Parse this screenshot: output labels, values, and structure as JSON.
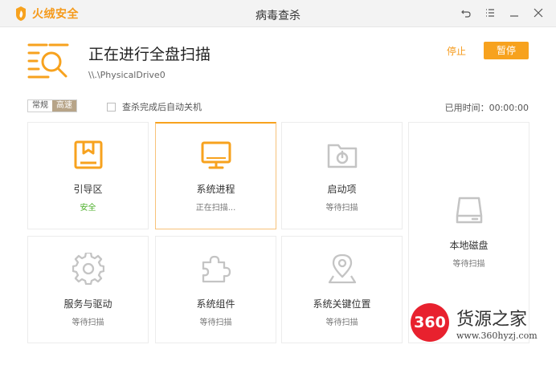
{
  "app": {
    "brand_name": "火绒安全",
    "window_title": "病毒查杀"
  },
  "header": {
    "scan_title": "正在进行全盘扫描",
    "scan_path": "\\\\.\\PhysicalDrive0",
    "stop_label": "停止",
    "pause_label": "暂停"
  },
  "options": {
    "mode_normal": "常规",
    "mode_fast": "高速",
    "auto_shutdown_label": "查杀完成后自动关机",
    "auto_shutdown_checked": false,
    "elapsed_label": "已用时间：00:00:00"
  },
  "cards": [
    {
      "name": "引导区",
      "status": "安全",
      "icon": "bookmark-box-icon"
    },
    {
      "name": "系统进程",
      "status": "正在扫描...",
      "icon": "monitor-icon"
    },
    {
      "name": "启动项",
      "status": "等待扫描",
      "icon": "power-folder-icon"
    },
    {
      "name": "本地磁盘",
      "status": "等待扫描",
      "icon": "disk-icon"
    },
    {
      "name": "服务与驱动",
      "status": "等待扫描",
      "icon": "gear-icon"
    },
    {
      "name": "系统组件",
      "status": "等待扫描",
      "icon": "puzzle-icon"
    },
    {
      "name": "系统关键位置",
      "status": "等待扫描",
      "icon": "location-pin-icon"
    }
  ],
  "colors": {
    "accent": "#f7a21e",
    "safe": "#4caf2a",
    "icon_inactive": "#c4c4c4"
  },
  "watermark": {
    "badge": "360",
    "name": "货源之家",
    "url": "www.360hyzj.com"
  }
}
